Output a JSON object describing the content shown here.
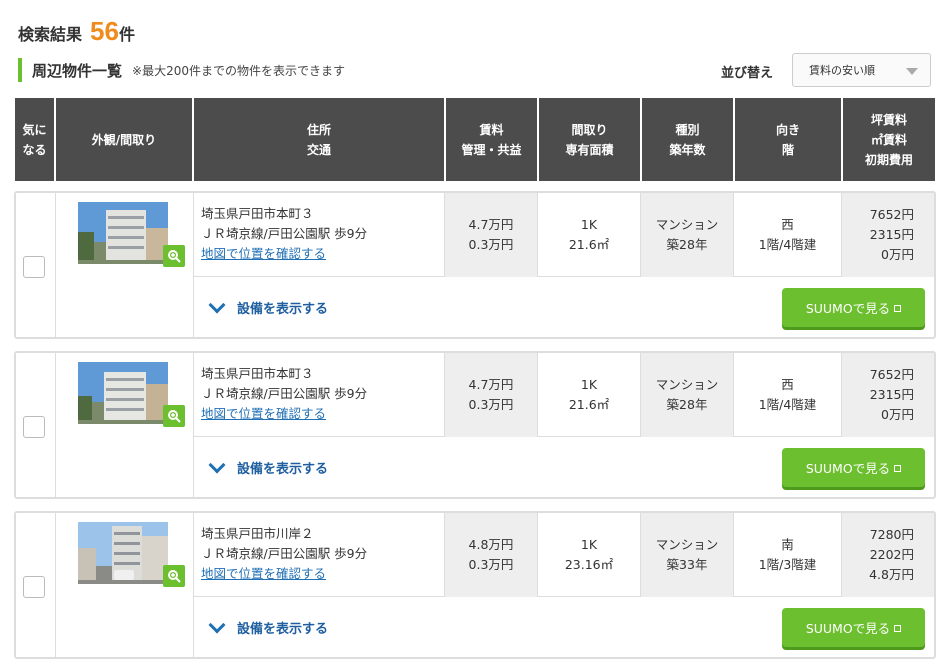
{
  "header": {
    "result_label": "検索結果",
    "result_count": "56",
    "result_unit": "件",
    "section_title": "周辺物件一覧",
    "section_note": "※最大200件までの物件を表示できます",
    "sort_label": "並び替え",
    "sort_value": "賃料の安い順"
  },
  "columns": [
    "気に\nなる",
    "外観/間取り",
    "住所\n交通",
    "賃料\n管理・共益",
    "間取り\n専有面積",
    "種別\n築年数",
    "向き\n階",
    "坪賃料\n㎡賃料\n初期費用"
  ],
  "listings": [
    {
      "address": "埼玉県戸田市本町３",
      "access": "ＪＲ埼京線/戸田公園駅 歩9分",
      "map_link": "地図で位置を確認する",
      "rent": "4.7万円",
      "fee": "0.3万円",
      "layout": "1K",
      "area": "21.6㎡",
      "type": "マンション",
      "age": "築28年",
      "direction": "西",
      "floor": "1階/4階建",
      "tsubo_rent": "7652円",
      "sqm_rent": "2315円",
      "initial_cost": "0万円",
      "facility_label": "設備を表示する",
      "suumo_label": "SUUMOで見る"
    },
    {
      "address": "埼玉県戸田市本町３",
      "access": "ＪＲ埼京線/戸田公園駅 歩9分",
      "map_link": "地図で位置を確認する",
      "rent": "4.7万円",
      "fee": "0.3万円",
      "layout": "1K",
      "area": "21.6㎡",
      "type": "マンション",
      "age": "築28年",
      "direction": "西",
      "floor": "1階/4階建",
      "tsubo_rent": "7652円",
      "sqm_rent": "2315円",
      "initial_cost": "0万円",
      "facility_label": "設備を表示する",
      "suumo_label": "SUUMOで見る"
    },
    {
      "address": "埼玉県戸田市川岸２",
      "access": "ＪＲ埼京線/戸田公園駅 歩9分",
      "map_link": "地図で位置を確認する",
      "rent": "4.8万円",
      "fee": "0.3万円",
      "layout": "1K",
      "area": "23.16㎡",
      "type": "マンション",
      "age": "築33年",
      "direction": "南",
      "floor": "1階/3階建",
      "tsubo_rent": "7280円",
      "sqm_rent": "2202円",
      "initial_cost": "4.8万円",
      "facility_label": "設備を表示する",
      "suumo_label": "SUUMOで見る"
    }
  ],
  "icons": {
    "zoom": "zoom-in-icon",
    "expand": "chevron-down-icon",
    "external": "external-link-icon",
    "dropdown": "caret-down-icon"
  },
  "colors": {
    "accent_orange": "#f08c1e",
    "accent_green": "#6cbf2e",
    "header_dark": "#4c4c4c",
    "link_blue": "#1f6fb5"
  }
}
